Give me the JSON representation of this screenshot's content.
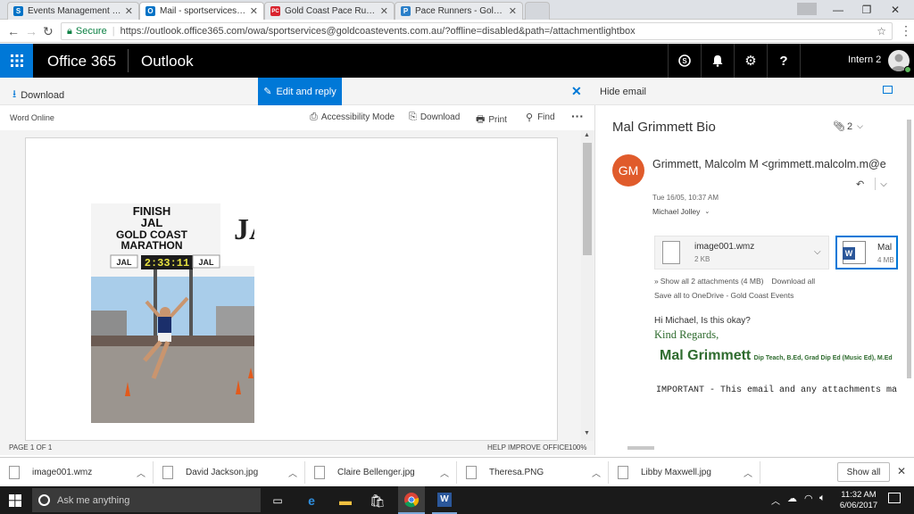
{
  "browser": {
    "tabs": [
      {
        "label": "Events Management Que",
        "favicon": "S",
        "favicon_color": "#0072c6",
        "active": false
      },
      {
        "label": "Mail - sportservices@go",
        "favicon": "O",
        "favicon_color": "#0072c6",
        "active": true
      },
      {
        "label": "Gold Coast Pace Runners",
        "favicon": "PC",
        "favicon_color": "#d9232e",
        "active": false
      },
      {
        "label": "Pace Runners - Gold Coa",
        "favicon": "P",
        "favicon_color": "#2a7fc9",
        "active": false
      }
    ],
    "address": {
      "secure_label": "Secure",
      "url": "https://outlook.office365.com/owa/sportservices@goldcoastevents.com.au/?offline=disabled&path=/attachmentlightbox"
    }
  },
  "o365": {
    "brand": "Office 365",
    "app": "Outlook",
    "user_name": "Intern 2",
    "icons": [
      "skype-icon",
      "bell-icon",
      "gear-icon",
      "help-icon"
    ]
  },
  "actionbar": {
    "download_label": "Download",
    "edit_reply_label": "Edit and reply",
    "hide_email_label": "Hide email"
  },
  "viewer": {
    "app_label": "Word Online",
    "accessibility_label": "Accessibility Mode",
    "download_label": "Download",
    "print_label": "Print",
    "find_label": "Find",
    "page_status": "PAGE 1 OF 1",
    "help_improve": "HELP IMPROVE OFFICE",
    "zoom": "100%",
    "photo": {
      "sign_line1": "FINISH",
      "sign_line2": "JAL",
      "sign_line3": "GOLD COAST",
      "sign_line4": "MARATHON",
      "sponsor": "JAL",
      "clock": "2:33:11"
    }
  },
  "email": {
    "subject": "Mal Grimmett Bio",
    "attachment_count": "2",
    "sender_initials": "GM",
    "sender": "Grimmett, Malcolm M <grimmett.malcolm.m@e",
    "date": "Tue 16/05, 10:37 AM",
    "to": "Michael Jolley",
    "attachments": [
      {
        "name": "image001.wmz",
        "size": "2 KB"
      },
      {
        "name": "Mal",
        "size": "4 MB"
      }
    ],
    "show_all": "Show all 2 attachments (4 MB)",
    "download_all": "Download all",
    "save_onedrive": "Save all to OneDrive - Gold Coast Events",
    "greeting": "Hi Michael, Is this okay?",
    "regards": "Kind Regards,",
    "signature_name": "Mal Grimmett",
    "signature_quals": "Dip Teach, B.Ed, Grad Dip Ed (Music Ed), M.Ed",
    "important": "IMPORTANT - This email and any attachments ma"
  },
  "downloads": {
    "items": [
      "image001.wmz",
      "David Jackson.jpg",
      "Claire Bellenger.jpg",
      "Theresa.PNG",
      "Libby Maxwell.jpg"
    ],
    "show_all": "Show all"
  },
  "taskbar": {
    "search_placeholder": "Ask me anything",
    "time": "11:32 AM",
    "date": "6/06/2017"
  },
  "colors": {
    "o365_blue": "#0078d7",
    "header_black": "#000000",
    "avatar_orange": "#e05b2b",
    "signature_green": "#2e6b2e"
  }
}
